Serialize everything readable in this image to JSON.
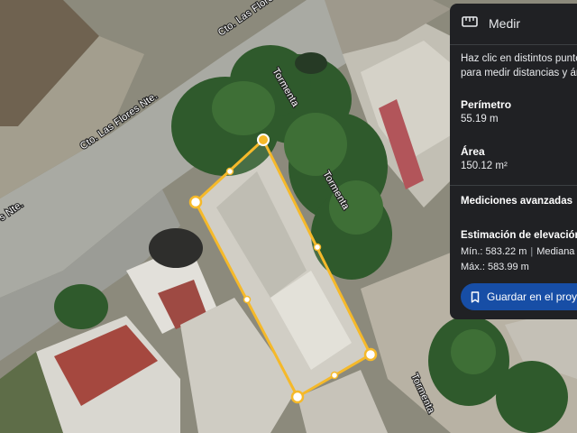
{
  "map": {
    "street_labels": [
      "Cto. Las Flores Nte.",
      "Cto. Las Flores Nte.",
      "s Nte."
    ],
    "tormenta_labels": [
      "Tormenta",
      "Tormenta",
      "Tormenta"
    ],
    "measure_color": "#f5b92a"
  },
  "panel": {
    "title": "Medir",
    "icon": "ruler-icon",
    "instructions": "Haz clic en distintos puntos del mapa para medir distancias y áreas",
    "perimeter_label": "Perímetro",
    "perimeter_value": "55.19 m",
    "area_label": "Área",
    "area_value": "150.12 m²",
    "advanced_label": "Mediciones avanzadas",
    "elevation_label": "Estimación de elevación",
    "min_label": "Mín.: 583.22 m",
    "median_label": "Mediana",
    "max_label": "Máx.: 583.99 m",
    "save_label": "Guardar en el proyecto",
    "save_icon": "bookmark-icon",
    "accent_color": "#174ea6"
  }
}
